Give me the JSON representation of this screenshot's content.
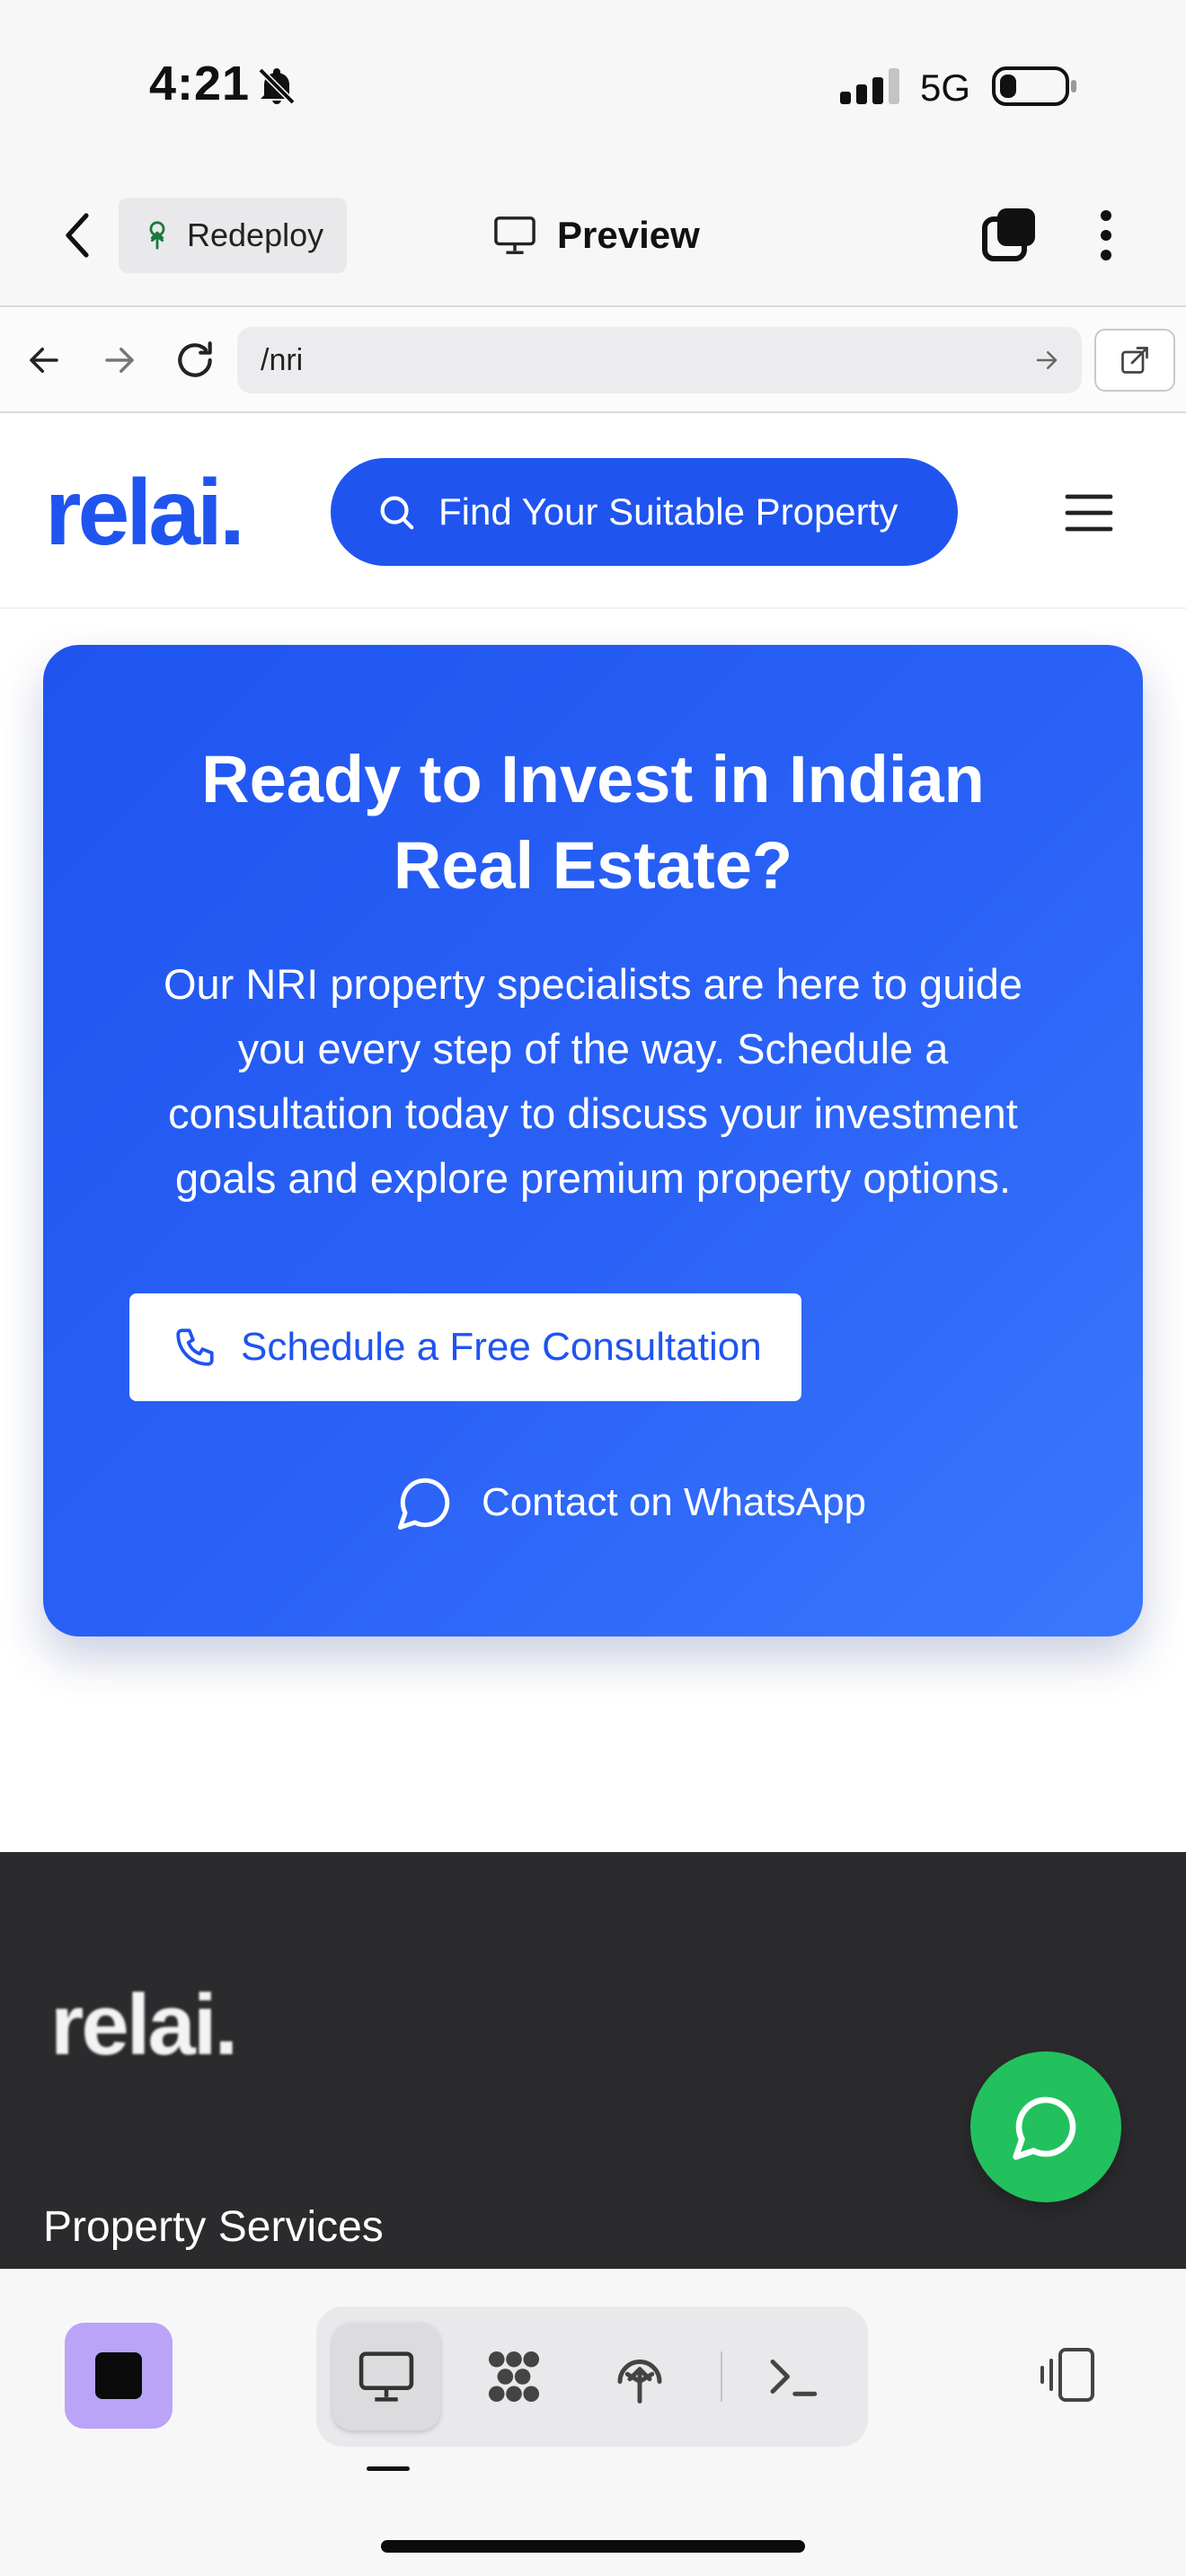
{
  "status_bar": {
    "time": "4:21",
    "network": "5G"
  },
  "app_toolbar": {
    "redeploy_label": "Redeploy",
    "preview_label": "Preview"
  },
  "browser": {
    "url": "/nri"
  },
  "site_header": {
    "logo_text": "relai.",
    "search_label": "Find Your Suitable Property"
  },
  "cta": {
    "title": "Ready to Invest in Indian Real Estate?",
    "body": "Our NRI property specialists are here to guide you every step of the way. Schedule a consultation today to discuss your investment goals and explore premium property options.",
    "consult_label": "Schedule a Free Consultation",
    "whatsapp_label": "Contact on WhatsApp"
  },
  "footer": {
    "logo_text": "relai.",
    "heading": "Property Services"
  },
  "colors": {
    "brand_blue": "#1f54ef",
    "footer_bg": "#2b2b2e",
    "whatsapp_green": "#22c15e",
    "stop_button": "#b9a4f7"
  },
  "icons": [
    "bell-off-icon",
    "signal-icon",
    "battery-icon",
    "chevron-left-icon",
    "tree-icon",
    "monitor-icon",
    "tabs-icon",
    "more-vertical-icon",
    "arrow-left-icon",
    "arrow-right-icon",
    "reload-icon",
    "external-link-icon",
    "search-icon",
    "menu-icon",
    "phone-icon",
    "chat-bubble-icon",
    "stop-icon",
    "grid-icon",
    "deploy-icon",
    "terminal-icon",
    "layout-toggle-icon"
  ]
}
